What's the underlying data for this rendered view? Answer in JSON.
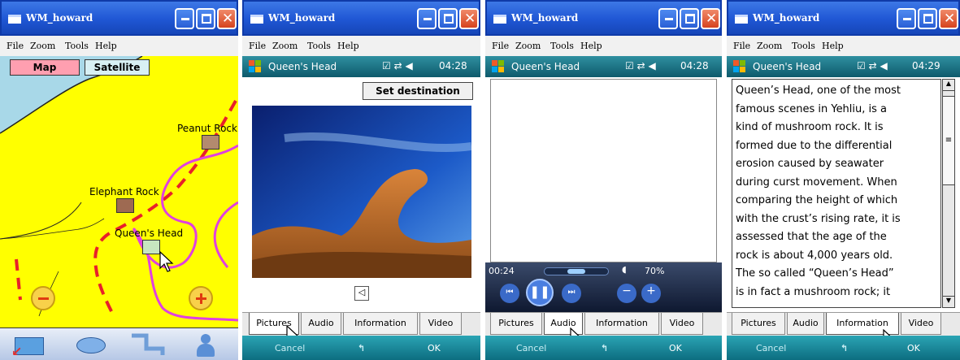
{
  "window_title": "WM_howard",
  "menu": [
    "File",
    "Zoom",
    "Tools",
    "Help"
  ],
  "status": {
    "location": "Queen's Head",
    "time_a": "04:28",
    "time_b": "04:29"
  },
  "tabs": [
    "Pictures",
    "Audio",
    "Information",
    "Video"
  ],
  "softkeys": {
    "left": "Cancel",
    "right": "OK"
  },
  "screen1": {
    "map_button": "Map",
    "satellite_button": "Satellite",
    "poi": [
      "Peanut Rock",
      "Elephant Rock",
      "Queen's Head"
    ]
  },
  "screen2": {
    "set_destination": "Set destination"
  },
  "screen3": {
    "elapsed": "00:24",
    "volume": "70%"
  },
  "screen4": {
    "text_lines": [
      "Queen’s Head, one of the most",
      "famous scenes in Yehliu, is a",
      "kind of mushroom rock.  It is",
      "formed due to the differential",
      "erosion caused by seawater",
      "during curst movement.  When",
      "comparing the height of which",
      "with the crust’s rising rate, it is",
      "assessed that the age of the",
      "rock is about 4,000 years old.",
      "The so called “Queen’s Head”",
      "is in fact a mushroom rock; it"
    ]
  },
  "colors": {
    "map_land": "#ffff00",
    "map_sea": "#a8d8e8",
    "route": "#e8202a",
    "trail": "#e040e0",
    "status_bar": "#1a6f80"
  }
}
